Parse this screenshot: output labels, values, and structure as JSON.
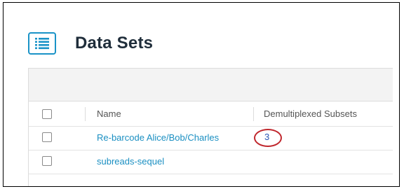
{
  "page": {
    "title": "Data Sets",
    "list_icon": "list-icon"
  },
  "table": {
    "columns": [
      "Name",
      "Demultiplexed Subsets"
    ],
    "rows": [
      {
        "name": "Re-barcode Alice/Bob/Charles",
        "subsets": "3",
        "highlighted": true
      },
      {
        "name": "subreads-sequel",
        "subsets": ""
      }
    ]
  },
  "colors": {
    "accent": "#1a93c7",
    "link": "#1a8fc2",
    "count_link": "#2855b5",
    "highlight_circle": "#c0272d"
  }
}
